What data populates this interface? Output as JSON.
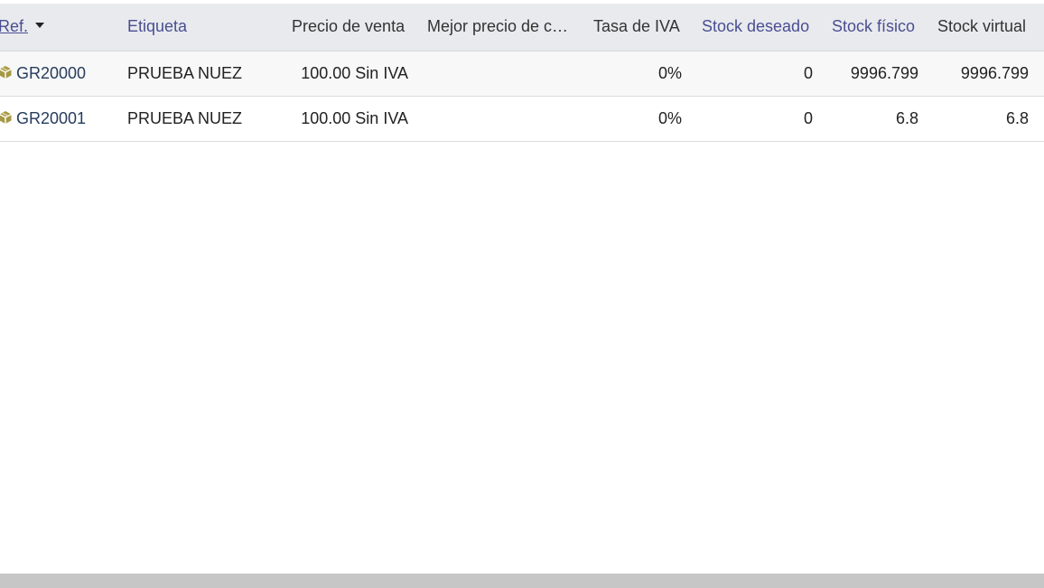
{
  "table": {
    "headers": {
      "ref": "Ref.",
      "label": "Etiqueta",
      "sell_price": "Precio de venta",
      "best_price": "Mejor precio de c…",
      "vat_rate": "Tasa de IVA",
      "desired_stock": "Stock deseado",
      "physical_stock": "Stock físico",
      "virtual_stock": "Stock virtual"
    },
    "rows": [
      {
        "ref": "GR20000",
        "label": "PRUEBA NUEZ",
        "sell_price": "100.00 Sin IVA",
        "best_price": "",
        "vat_rate": "0%",
        "desired_stock": "0",
        "physical_stock": "9996.799",
        "virtual_stock": "9996.799"
      },
      {
        "ref": "GR20001",
        "label": "PRUEBA NUEZ",
        "sell_price": "100.00 Sin IVA",
        "best_price": "",
        "vat_rate": "0%",
        "desired_stock": "0",
        "physical_stock": "6.8",
        "virtual_stock": "6.8"
      }
    ]
  },
  "icons": {
    "product": "cube-icon",
    "sort": "caret-down-icon"
  },
  "colors": {
    "header_bg": "#e9eaed",
    "link": "#4a4e93",
    "ref_link": "#263c5c",
    "icon": "#a69944"
  }
}
